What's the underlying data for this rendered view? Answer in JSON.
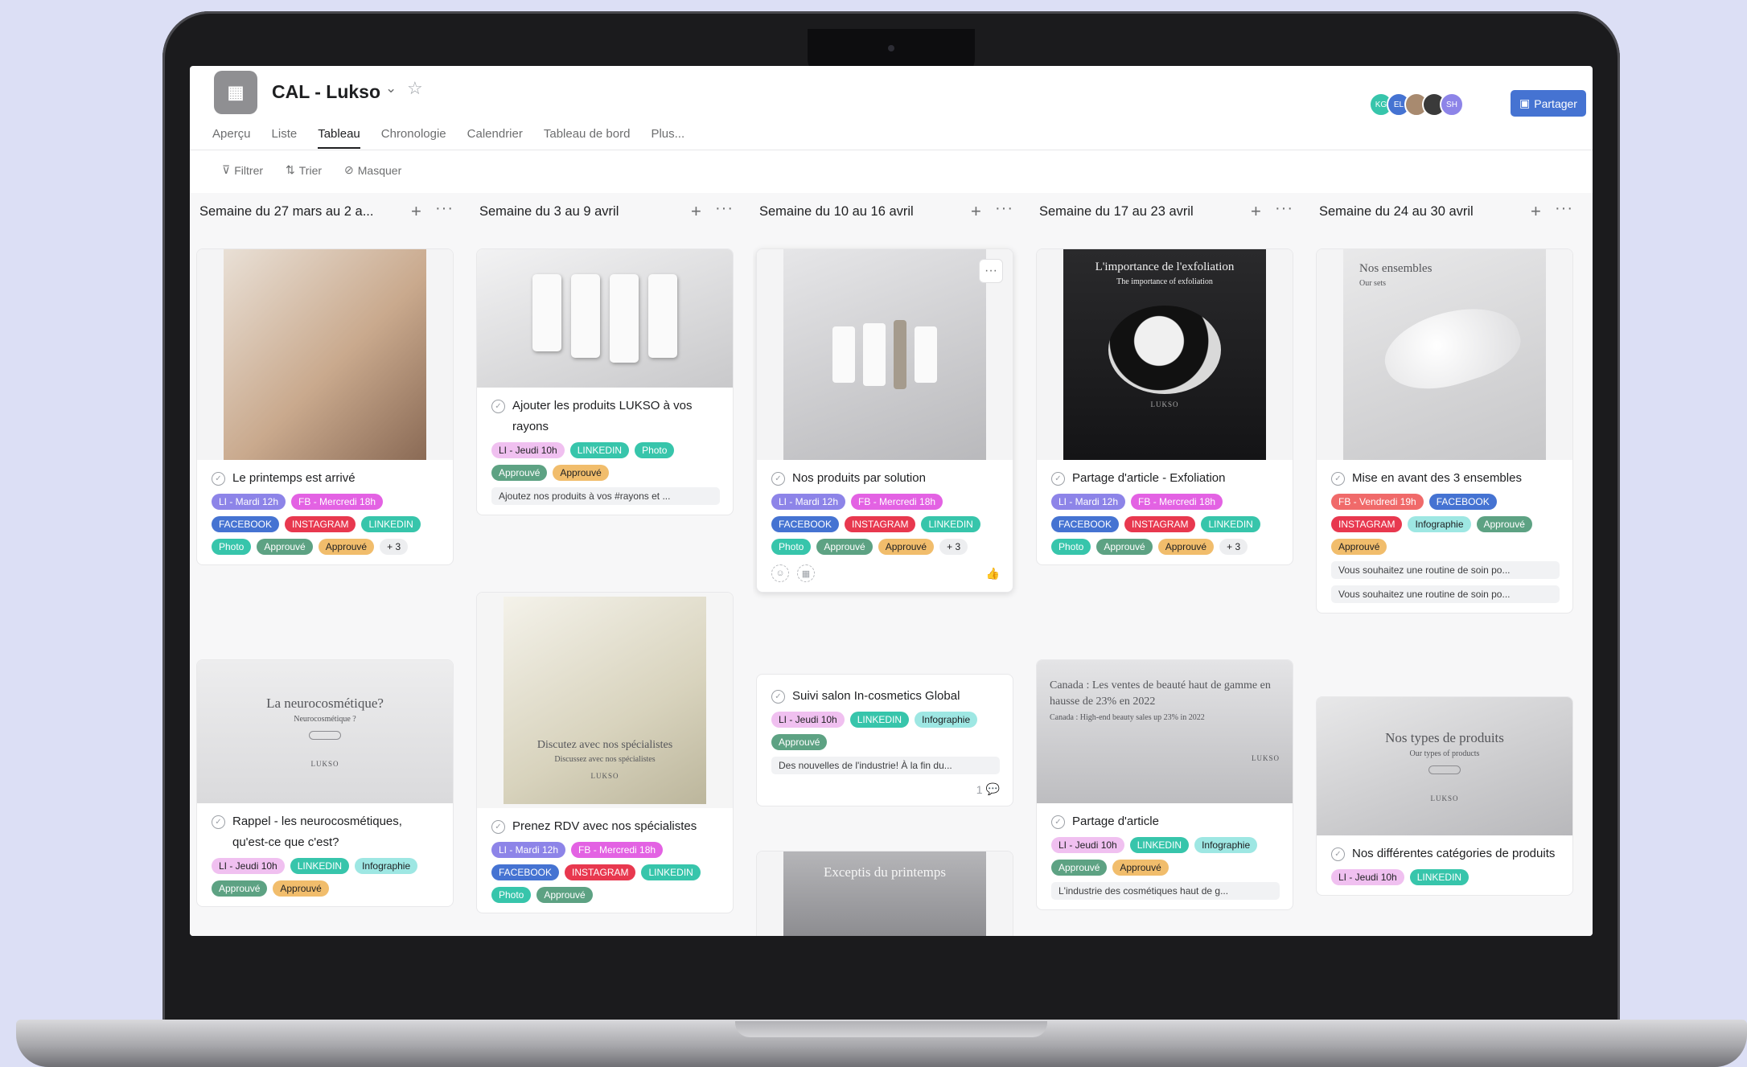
{
  "project": {
    "title": "CAL - Lukso",
    "icon": "board-icon",
    "share_label": "Partager"
  },
  "avatars": [
    {
      "initials": "KG",
      "color": "#37c5ab"
    },
    {
      "initials": "EL",
      "color": "#4573d2"
    },
    {
      "initials": "",
      "color": "#a88a6f"
    },
    {
      "initials": "",
      "color": "#3a3a3a"
    },
    {
      "initials": "SH",
      "color": "#8d84e8"
    }
  ],
  "tabs": [
    "Aperçu",
    "Liste",
    "Tableau",
    "Chronologie",
    "Calendrier",
    "Tableau de bord",
    "Plus..."
  ],
  "active_tab": "Tableau",
  "toolbar": {
    "filter": "Filtrer",
    "sort": "Trier",
    "hide": "Masquer"
  },
  "columns": [
    {
      "title": "Semaine du 27 mars au 2 a...",
      "cards": [
        {
          "title": "Le printemps est arrivé",
          "tags": [
            "LI - Mardi 12h",
            "FB - Mercredi 18h",
            "FACEBOOK",
            "INSTAGRAM",
            "LINKEDIN",
            "Photo",
            "Approuvé",
            "Approuvé",
            "+ 3"
          ]
        },
        {
          "image_text": "La neurocosmétique?",
          "image_sub": "Neurocosmétique ?",
          "image_brand": "LUKSO",
          "title": "Rappel - les neurocosmétiques, qu'est-ce que c'est?",
          "tags": [
            "LI - Jeudi 10h",
            "LINKEDIN",
            "Infographie",
            "Approuvé",
            "Approuvé"
          ]
        }
      ]
    },
    {
      "title": "Semaine du 3 au 9 avril",
      "cards": [
        {
          "title": "Ajouter les produits LUKSO à vos rayons",
          "tags": [
            "LI - Jeudi 10h",
            "LINKEDIN",
            "Photo",
            "Approuvé",
            "Approuvé"
          ],
          "desc": "Ajoutez nos produits à vos #rayons et ..."
        },
        {
          "image_text": "Discutez avec nos spécialistes",
          "image_sub": "Discussez avec nos spécialistes",
          "image_brand": "LUKSO",
          "title": "Prenez RDV avec nos spécialistes",
          "tags": [
            "LI - Mardi 12h",
            "FB - Mercredi 18h",
            "FACEBOOK",
            "INSTAGRAM",
            "LINKEDIN",
            "Photo",
            "Approuvé"
          ]
        }
      ]
    },
    {
      "title": "Semaine du 10 au 16 avril",
      "cards": [
        {
          "title": "Nos produits par solution",
          "tags": [
            "LI - Mardi 12h",
            "FB - Mercredi 18h",
            "FACEBOOK",
            "INSTAGRAM",
            "LINKEDIN",
            "Photo",
            "Approuvé",
            "Approuvé",
            "+ 3"
          ]
        },
        {
          "title": "Suivi salon In-cosmetics Global",
          "tags": [
            "LI - Jeudi 10h",
            "LINKEDIN",
            "Infographie",
            "Approuvé"
          ],
          "desc": "Des nouvelles de l'industrie! À la fin du...",
          "comments": "1"
        },
        {
          "image_text": "Exceptis du printemps"
        }
      ]
    },
    {
      "title": "Semaine du 17 au 23 avril",
      "cards": [
        {
          "image_text": "L'importance de l'exfoliation",
          "image_sub": "The importance of exfoliation",
          "image_brand": "LUKSO",
          "title": "Partage d'article - Exfoliation",
          "tags": [
            "LI - Mardi 12h",
            "FB - Mercredi 18h",
            "FACEBOOK",
            "INSTAGRAM",
            "LINKEDIN",
            "Photo",
            "Approuvé",
            "Approuvé",
            "+ 3"
          ]
        },
        {
          "image_text": "Canada : Les ventes de beauté haut de gamme en hausse de 23% en 2022",
          "image_sub": "Canada : High-end beauty sales up 23% in 2022",
          "image_brand": "LUKSO",
          "title": "Partage d'article",
          "tags": [
            "LI - Jeudi 10h",
            "LINKEDIN",
            "Infographie",
            "Approuvé",
            "Approuvé"
          ],
          "desc": "L'industrie des cosmétiques haut de g..."
        }
      ]
    },
    {
      "title": "Semaine du 24 au 30 avril",
      "cards": [
        {
          "image_text": "Nos ensembles",
          "image_sub": "Our sets",
          "title": "Mise en avant des 3 ensembles",
          "tags": [
            "FB - Vendredi 19h",
            "FACEBOOK",
            "INSTAGRAM",
            "Infographie",
            "Approuvé",
            "Approuvé"
          ],
          "desc": "Vous souhaitez une routine de soin po...",
          "desc2": "Vous souhaitez une routine de soin po..."
        },
        {
          "image_text": "Nos types de produits",
          "image_sub": "Our types of products",
          "image_brand": "LUKSO",
          "title": "Nos différentes catégories de produits",
          "tags": [
            "LI - Jeudi 10h",
            "LINKEDIN"
          ]
        }
      ]
    }
  ]
}
